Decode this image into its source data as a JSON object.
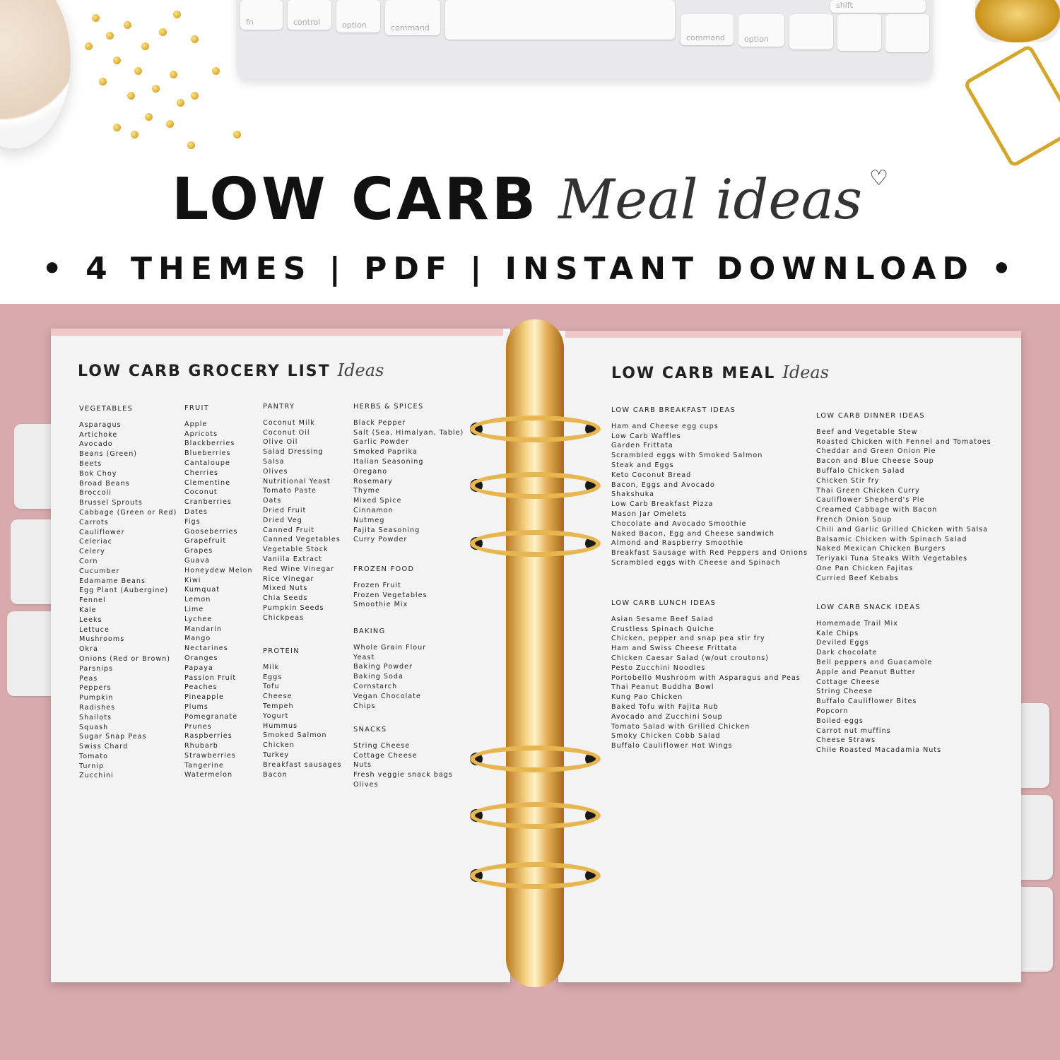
{
  "header": {
    "title_bold": "LOW CARB",
    "title_script": "Meal ideas",
    "subtitle": "• 4 THEMES | PDF | INSTANT DOWNLOAD •"
  },
  "keyboard": {
    "keys": [
      "fn",
      "control",
      "option",
      "command",
      "command",
      "option",
      "shift"
    ]
  },
  "left_page": {
    "title": "LOW CARB GROCERY LIST",
    "title_script": "Ideas",
    "vegetables": {
      "heading": "VEGETABLES",
      "items": [
        "Asparagus",
        "Artichoke",
        "Avocado",
        "Beans (Green)",
        "Beets",
        "Bok Choy",
        "Broad Beans",
        "Broccoli",
        "Brussel Sprouts",
        "Cabbage (Green or Red)",
        "Carrots",
        "Cauliflower",
        "Celeriac",
        "Celery",
        "Corn",
        "Cucumber",
        "Edamame Beans",
        "Egg Plant (Aubergine)",
        "Fennel",
        "Kale",
        "Leeks",
        "Lettuce",
        "Mushrooms",
        "Okra",
        "Onions (Red or Brown)",
        "Parsnips",
        "Peas",
        "Peppers",
        "Pumpkin",
        "Radishes",
        "Shallots",
        "Squash",
        "Sugar Snap Peas",
        "Swiss Chard",
        "Tomato",
        "Turnip",
        "Zucchini"
      ]
    },
    "fruit": {
      "heading": "FRUIT",
      "items": [
        "Apple",
        "Apricots",
        "Blackberries",
        "Blueberries",
        "Cantaloupe",
        "Cherries",
        "Clementine",
        "Coconut",
        "Cranberries",
        "Dates",
        "Figs",
        "Gooseberries",
        "Grapefruit",
        "Grapes",
        "Guava",
        "Honeydew Melon",
        "Kiwi",
        "Kumquat",
        "Lemon",
        "Lime",
        "Lychee",
        "Mandarin",
        "Mango",
        "Nectarines",
        "Oranges",
        "Papaya",
        "Passion Fruit",
        "Peaches",
        "Pineapple",
        "Plums",
        "Pomegranate",
        "Prunes",
        "Raspberries",
        "Rhubarb",
        "Strawberries",
        "Tangerine",
        "Watermelon"
      ]
    },
    "pantry": {
      "heading": "PANTRY",
      "items": [
        "Coconut Milk",
        "Coconut Oil",
        "Olive Oil",
        "Salad Dressing",
        "Salsa",
        "Olives",
        "Nutritional Yeast",
        "Tomato Paste",
        "Oats",
        "Dried Fruit",
        "Dried Veg",
        "Canned Fruit",
        "Canned Vegetables",
        "Vegetable Stock",
        "Vanilla Extract",
        "Red Wine Vinegar",
        "Rice Vinegar",
        "Mixed Nuts",
        "Chia Seeds",
        "Pumpkin Seeds",
        "Chickpeas"
      ]
    },
    "protein": {
      "heading": "PROTEIN",
      "items": [
        "Milk",
        "Eggs",
        "Tofu",
        "Cheese",
        "Tempeh",
        "Yogurt",
        "Hummus",
        "Smoked Salmon",
        "Chicken",
        "Turkey",
        "Breakfast sausages",
        "Bacon"
      ]
    },
    "herbs": {
      "heading": "HERBS & SPICES",
      "items": [
        "Black Pepper",
        "Salt (Sea, Himalyan, Table)",
        "Garlic Powder",
        "Smoked Paprika",
        "Italian Seasoning",
        "Oregano",
        "Rosemary",
        "Thyme",
        "Mixed Spice",
        "Cinnamon",
        "Nutmeg",
        "Fajita Seasoning",
        "Curry Powder"
      ]
    },
    "frozen": {
      "heading": "FROZEN FOOD",
      "items": [
        "Frozen Fruit",
        "Frozen Vegetables",
        "Smoothie Mix"
      ]
    },
    "baking": {
      "heading": "BAKING",
      "items": [
        "Whole Grain Flour",
        "Yeast",
        "Baking Powder",
        "Baking Soda",
        "Cornstarch",
        "Vegan Chocolate",
        "Chips"
      ]
    },
    "snacks": {
      "heading": "SNACKS",
      "items": [
        "String Cheese",
        "Cottage Cheese",
        "Nuts",
        "Fresh veggie snack bags",
        "Olives"
      ]
    }
  },
  "right_page": {
    "title": "LOW CARB MEAL",
    "title_script": "Ideas",
    "breakfast": {
      "heading": "LOW CARB BREAKFAST IDEAS",
      "items": [
        "Ham and Cheese egg cups",
        "Low Carb Waffles",
        "Garden Frittata",
        "Scrambled eggs with Smoked Salmon",
        "Steak and Eggs",
        "Keto Coconut Bread",
        "Bacon, Eggs and Avocado",
        "Shakshuka",
        "Low Carb Breakfast Pizza",
        "Mason Jar Omelets",
        "Chocolate and Avocado Smoothie",
        "Naked Bacon, Egg and Cheese sandwich",
        "Almond and Raspberry Smoothie",
        "Breakfast Sausage with Red Peppers and Onions",
        "Scrambled eggs with Cheese and Spinach"
      ]
    },
    "lunch": {
      "heading": "LOW CARB LUNCH IDEAS",
      "items": [
        "Asian Sesame Beef Salad",
        "Crustless Spinach Quiche",
        "Chicken, pepper and snap pea stir fry",
        "Ham and Swiss Cheese Frittata",
        "Chicken Caesar Salad (w/out croutons)",
        "Pesto Zucchini Noodles",
        "Portobello Mushroom with Asparagus and Peas",
        "Thai Peanut Buddha Bowl",
        "Kung Pao Chicken",
        "Baked Tofu with Fajita Rub",
        "Avocado and Zucchini Soup",
        "Tomato Salad with Grilled Chicken",
        "Smoky Chicken Cobb Salad",
        "Buffalo Cauliflower Hot Wings"
      ]
    },
    "dinner": {
      "heading": "LOW CARB DINNER IDEAS",
      "items": [
        "Beef and Vegetable Stew",
        "Roasted Chicken with Fennel and Tomatoes",
        "Cheddar and Green Onion Pie",
        "Bacon and Blue Cheese Soup",
        "Buffalo Chicken Salad",
        "Chicken Stir fry",
        "Thai Green Chicken Curry",
        "Cauliflower Shepherd's Pie",
        "Creamed Cabbage with Bacon",
        "French Onion Soup",
        "Chili and Garlic Grilled Chicken with Salsa",
        "Balsamic Chicken with Spinach Salad",
        "Naked Mexican Chicken Burgers",
        "Teriyaki Tuna Steaks With Vegetables",
        "One Pan Chicken Fajitas",
        "Curried Beef Kebabs"
      ]
    },
    "snack": {
      "heading": "LOW CARB SNACK IDEAS",
      "items": [
        "Homemade Trail Mix",
        "Kale Chips",
        "Deviled Eggs",
        "Dark chocolate",
        "Bell peppers and Guacamole",
        "Apple and Peanut Butter",
        "Cottage Cheese",
        "String Cheese",
        "Buffalo Cauliflower Bites",
        "Popcorn",
        "Boiled eggs",
        "Carrot nut muffins",
        "Cheese Straws",
        "Chile Roasted Macadamia Nuts"
      ]
    }
  },
  "colors": {
    "binder": "#d8a9ad",
    "page": "#f3f3f3",
    "rings": "#e7b650",
    "text": "#222222"
  }
}
